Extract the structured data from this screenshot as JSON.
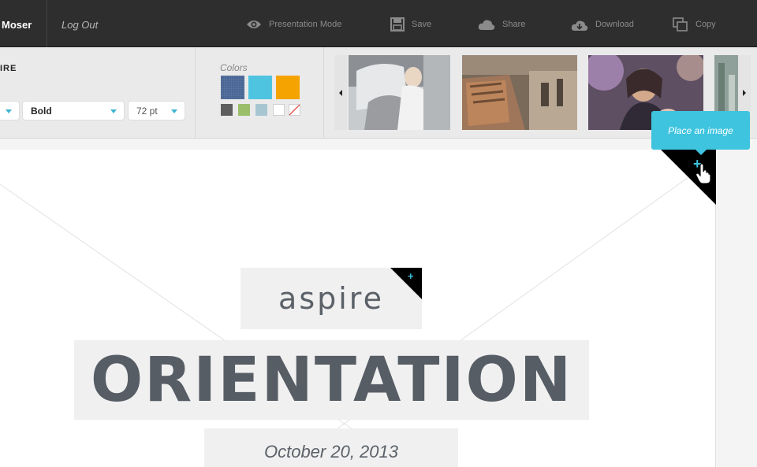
{
  "topbar": {
    "user_name": "Moser",
    "logout_label": "Log Out",
    "tools": {
      "presentation_label": "Presentation Mode",
      "save_label": "Save",
      "share_label": "Share",
      "download_label": "Download",
      "copy_label": "Copy"
    }
  },
  "font_panel": {
    "title": "IRE",
    "weight_value": "Bold",
    "size_value": "72 pt"
  },
  "colors_panel": {
    "label": "Colors",
    "large_swatches": [
      "#4a6592",
      "#4ec4e0",
      "#f5a300"
    ],
    "small_swatches": [
      "#5e5e5e",
      "#9bbe6b",
      "#a7c6d2",
      "#ffffff",
      "none"
    ]
  },
  "canvas": {
    "subtitle": "aspire",
    "headline": "ORIENTATION",
    "date": "October 20, 2013"
  },
  "tooltip": {
    "label": "Place an image"
  },
  "accent_color": "#3ec4df"
}
